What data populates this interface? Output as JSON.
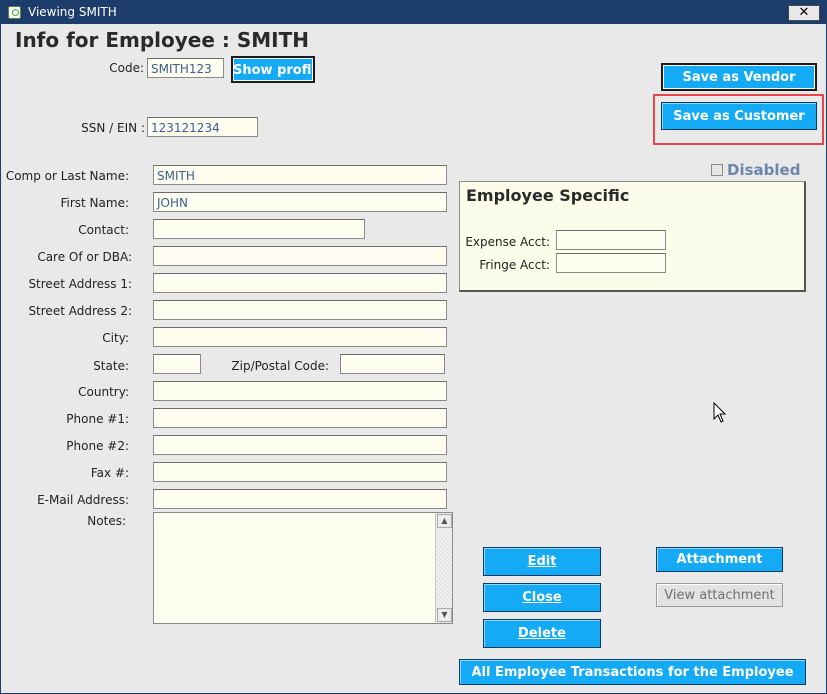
{
  "window": {
    "title": "Viewing SMITH",
    "close_glyph": "✕",
    "app_icon": "app-logo-icon"
  },
  "heading": "Info for Employee : SMITH",
  "code": {
    "label": "Code:",
    "value": "SMITH123",
    "show_profile": "Show profile"
  },
  "ssn": {
    "label": "SSN / EIN :",
    "value": "123121234"
  },
  "actions": {
    "save_vendor": "Save as Vendor",
    "save_customer": "Save as Customer"
  },
  "disabled": {
    "label": "Disabled",
    "checked": false
  },
  "form": {
    "comp_last_name": {
      "label": "Comp or Last Name:",
      "value": "SMITH"
    },
    "first_name": {
      "label": "First Name:",
      "value": "JOHN"
    },
    "contact": {
      "label": "Contact:",
      "value": ""
    },
    "care_of": {
      "label": "Care Of or DBA:",
      "value": ""
    },
    "street1": {
      "label": "Street Address 1:",
      "value": ""
    },
    "street2": {
      "label": "Street Address 2:",
      "value": ""
    },
    "city": {
      "label": "City:",
      "value": ""
    },
    "state": {
      "label": "State:",
      "value": ""
    },
    "zip": {
      "label": "Zip/Postal Code:",
      "value": ""
    },
    "country": {
      "label": "Country:",
      "value": ""
    },
    "phone1": {
      "label": "Phone #1:",
      "value": ""
    },
    "phone2": {
      "label": "Phone #2:",
      "value": ""
    },
    "fax": {
      "label": "Fax #:",
      "value": ""
    },
    "email": {
      "label": "E-Mail Address:",
      "value": ""
    },
    "notes": {
      "label": "Notes:",
      "value": ""
    }
  },
  "employee_specific": {
    "title": "Employee Specific",
    "expense_acct": {
      "label": "Expense Acct:",
      "value": ""
    },
    "fringe_acct": {
      "label": "Fringe Acct:",
      "value": ""
    }
  },
  "buttons": {
    "edit": "Edit",
    "close": "Close",
    "delete": "Delete",
    "attachment": "Attachment",
    "view_attachment": "View attachment",
    "all_transactions": "All  Employee Transactions for the Employee"
  },
  "colors": {
    "accent": "#14aaf5",
    "titlebar": "#1c3d6b",
    "field_bg": "#fdfef0",
    "highlight": "#e8454c"
  }
}
